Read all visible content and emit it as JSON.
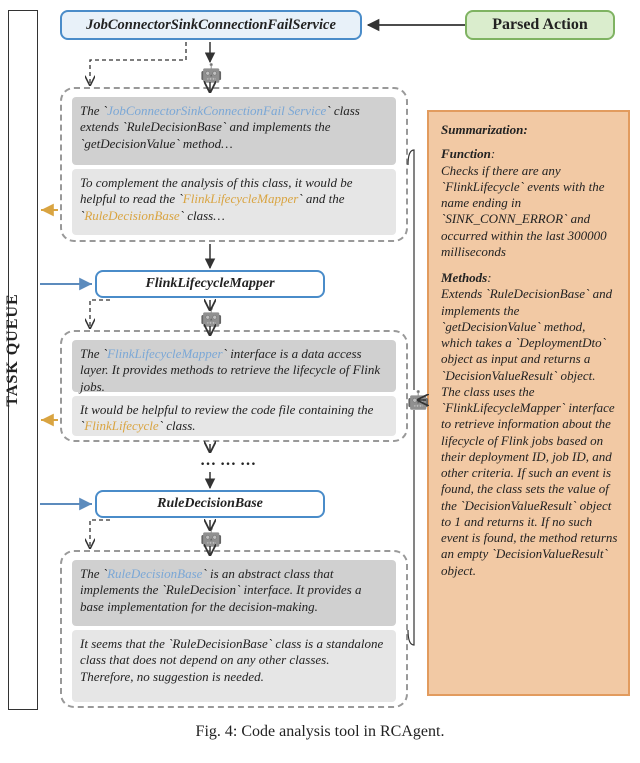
{
  "caption": "Fig. 4: Code analysis tool in RCAgent.",
  "task_queue_label": "TASK QUEUE",
  "top": {
    "service_class": "JobConnectorSinkConnectionFailService",
    "parsed_action": "Parsed Action"
  },
  "card1": {
    "a_pre": "The `",
    "a_blue": "JobConnectorSinkConnectionFail Service",
    "a_mid": "` class extends `",
    "a_code1": "RuleDecisionBase",
    "a_mid2": "` and implements the `",
    "a_code2": "getDecisionValue",
    "a_post": "` method…",
    "b_pre": "To complement the analysis of this class, it would be helpful to read the `",
    "b_gold1": "FlinkLifecycleMapper",
    "b_mid": "` and the `",
    "b_gold2": "RuleDecisionBase",
    "b_post": "` class…"
  },
  "class2_title": "FlinkLifecycleMapper",
  "card2": {
    "a_pre": "The `",
    "a_blue": "FlinkLifecycleMapper",
    "a_post": "` interface is a data access layer. It provides methods to retrieve the lifecycle of Flink jobs.",
    "b_pre": "It would be helpful to review the code file containing the `",
    "b_gold": "FlinkLifecycle",
    "b_post": "` class."
  },
  "ellipsis": "…  …  …",
  "class3_title": "RuleDecisionBase",
  "card3": {
    "a_pre": "The `",
    "a_blue": "RuleDecisionBase",
    "a_mid": "` is an abstract class that implements the `",
    "a_code": "RuleDecision",
    "a_post": "` interface. It provides a base implementation for the decision-making.",
    "b_pre": "It seems that the `",
    "b_code": "RuleDecisionBase",
    "b_mid": "` class is a standalone class that does not depend on any other classes.",
    "b_post": "Therefore, no suggestion is needed."
  },
  "summary": {
    "title": "Summarization:",
    "func_label": "Function",
    "func_body": "Checks if there are any `FlinkLifecycle` events with the name ending in `SINK_CONN_ERROR` and occurred within the last 300000 milliseconds",
    "meth_label": "Methods",
    "meth_body": "Extends `RuleDecisionBase` and implements the `getDecisionValue` method, which takes a `DeploymentDto` object as input and returns a `DecisionValueResult` object. The class uses the `FlinkLifecycleMapper` interface to retrieve information about the lifecycle of Flink jobs based on their deployment ID, job ID, and other criteria. If such an event is found, the class sets the value of the `DecisionValueResult` object to 1 and returns it. If no such event is found, the method returns an empty `DecisionValueResult` object."
  }
}
